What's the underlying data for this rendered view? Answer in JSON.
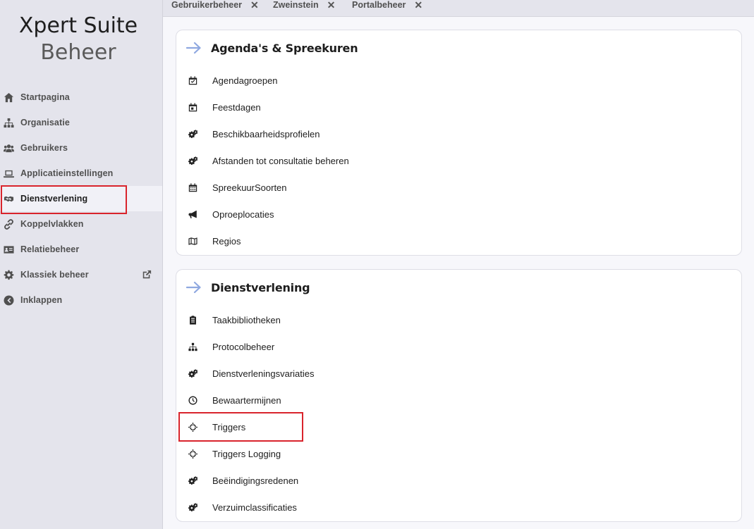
{
  "brand": {
    "line1": "Xpert Suite",
    "line2": "Beheer"
  },
  "tabs": [
    {
      "label": "Gebruikerbeheer"
    },
    {
      "label": "Zweinstein"
    },
    {
      "label": "Portalbeheer"
    }
  ],
  "tab_close_glyph": "✕",
  "sidebar": {
    "items": [
      {
        "label": "Startpagina",
        "icon": "home-icon"
      },
      {
        "label": "Organisatie",
        "icon": "sitemap-icon"
      },
      {
        "label": "Gebruikers",
        "icon": "users-icon"
      },
      {
        "label": "Applicatieinstellingen",
        "icon": "laptop-icon"
      },
      {
        "label": "Dienstverlening",
        "icon": "handshake-icon",
        "active": true
      },
      {
        "label": "Koppelvlakken",
        "icon": "link-icon"
      },
      {
        "label": "Relatiebeheer",
        "icon": "id-card-icon"
      },
      {
        "label": "Klassiek beheer",
        "icon": "gear-icon",
        "external": true
      },
      {
        "label": "Inklappen",
        "icon": "chevron-left-circle-icon"
      }
    ]
  },
  "cards": [
    {
      "title": "Agenda's & Spreekuren",
      "items": [
        {
          "label": "Agendagroepen",
          "icon": "calendar-check-icon"
        },
        {
          "label": "Feestdagen",
          "icon": "calendar-day-icon"
        },
        {
          "label": "Beschikbaarheidsprofielen",
          "icon": "cogs-icon"
        },
        {
          "label": "Afstanden tot consultatie beheren",
          "icon": "cogs-icon"
        },
        {
          "label": "SpreekuurSoorten",
          "icon": "calendar-grid-icon"
        },
        {
          "label": "Oproeplocaties",
          "icon": "bullhorn-icon"
        },
        {
          "label": "Regios",
          "icon": "map-icon"
        }
      ]
    },
    {
      "title": "Dienstverlening",
      "items": [
        {
          "label": "Taakbibliotheken",
          "icon": "clipboard-icon"
        },
        {
          "label": "Protocolbeheer",
          "icon": "sitemap-icon"
        },
        {
          "label": "Dienstverleningsvariaties",
          "icon": "cogs-icon"
        },
        {
          "label": "Bewaartermijnen",
          "icon": "clock-icon"
        },
        {
          "label": "Triggers",
          "icon": "crosshairs-icon"
        },
        {
          "label": "Triggers Logging",
          "icon": "crosshairs-icon"
        },
        {
          "label": "Beëindigingsredenen",
          "icon": "cogs-icon"
        },
        {
          "label": "Verzuimclassificaties",
          "icon": "cogs-icon"
        }
      ]
    }
  ],
  "colors": {
    "accent_arrow": "#8fa8e0",
    "highlight": "#d9242c"
  }
}
